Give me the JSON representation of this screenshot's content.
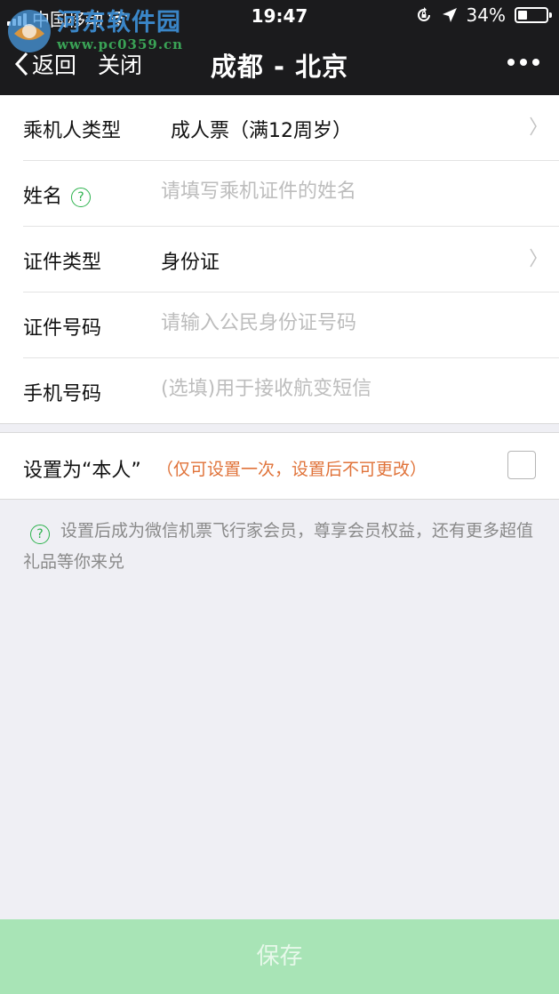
{
  "status_bar": {
    "carrier": "中国移动",
    "time": "19:47",
    "battery_percent": "34%",
    "battery_level": 0.34
  },
  "watermark": {
    "name": "河东软件园",
    "url": "www.pc0359.cn"
  },
  "nav": {
    "back_label": "返回",
    "close_label": "关闭",
    "title": "成都 - 北京",
    "more_icon": "more-dots-icon"
  },
  "form": {
    "passenger_type": {
      "label": "乘机人类型",
      "value": "成人票（满12周岁）"
    },
    "name": {
      "label": "姓名",
      "placeholder": "请填写乘机证件的姓名"
    },
    "id_type": {
      "label": "证件类型",
      "value": "身份证"
    },
    "id_number": {
      "label": "证件号码",
      "placeholder": "请输入公民身份证号码"
    },
    "phone": {
      "label": "手机号码",
      "placeholder": "(选填)用于接收航变短信"
    }
  },
  "self_setting": {
    "label": "设置为“本人”",
    "note": "（仅可设置一次，设置后不可更改）",
    "checked": false
  },
  "info": {
    "text": "设置后成为微信机票飞行家会员，尊享会员权益，还有更多超值礼品等你来兑"
  },
  "save": {
    "label": "保存"
  },
  "colors": {
    "header_bg": "#1b1b1d",
    "accent_green": "#2bb24c",
    "warning_orange": "#e0733a",
    "save_disabled_bg": "#a8e4b6",
    "page_bg": "#efeff4"
  }
}
